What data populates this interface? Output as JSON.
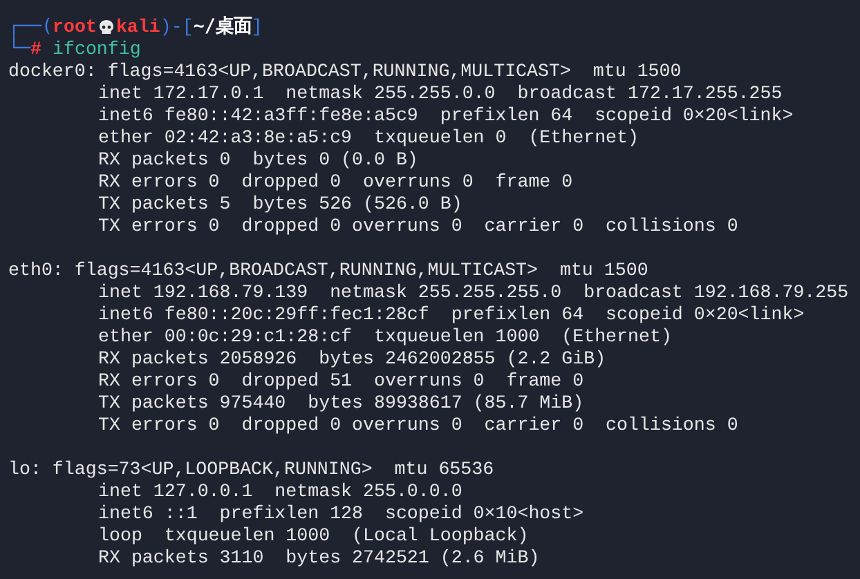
{
  "prompt": {
    "open": "┌──(",
    "user": "root",
    "host": "kali",
    "middle": ")-[",
    "directory": "~/桌面",
    "close": "]",
    "corner": "└─",
    "symbol": "#",
    "command": "ifconfig"
  },
  "interfaces": [
    {
      "header": "docker0: flags=4163<UP,BROADCAST,RUNNING,MULTICAST>  mtu 1500",
      "lines": [
        "inet 172.17.0.1  netmask 255.255.0.0  broadcast 172.17.255.255",
        "inet6 fe80::42:a3ff:fe8e:a5c9  prefixlen 64  scopeid 0×20<link>",
        "ether 02:42:a3:8e:a5:c9  txqueuelen 0  (Ethernet)",
        "RX packets 0  bytes 0 (0.0 B)",
        "RX errors 0  dropped 0  overruns 0  frame 0",
        "TX packets 5  bytes 526 (526.0 B)",
        "TX errors 0  dropped 0 overruns 0  carrier 0  collisions 0"
      ]
    },
    {
      "header": "eth0: flags=4163<UP,BROADCAST,RUNNING,MULTICAST>  mtu 1500",
      "lines": [
        "inet 192.168.79.139  netmask 255.255.255.0  broadcast 192.168.79.255",
        "inet6 fe80::20c:29ff:fec1:28cf  prefixlen 64  scopeid 0×20<link>",
        "ether 00:0c:29:c1:28:cf  txqueuelen 1000  (Ethernet)",
        "RX packets 2058926  bytes 2462002855 (2.2 GiB)",
        "RX errors 0  dropped 51  overruns 0  frame 0",
        "TX packets 975440  bytes 89938617 (85.7 MiB)",
        "TX errors 0  dropped 0 overruns 0  carrier 0  collisions 0"
      ]
    },
    {
      "header": "lo: flags=73<UP,LOOPBACK,RUNNING>  mtu 65536",
      "lines": [
        "inet 127.0.0.1  netmask 255.0.0.0",
        "inet6 ::1  prefixlen 128  scopeid 0×10<host>",
        "loop  txqueuelen 1000  (Local Loopback)",
        "RX packets 3110  bytes 2742521 (2.6 MiB)"
      ]
    }
  ]
}
